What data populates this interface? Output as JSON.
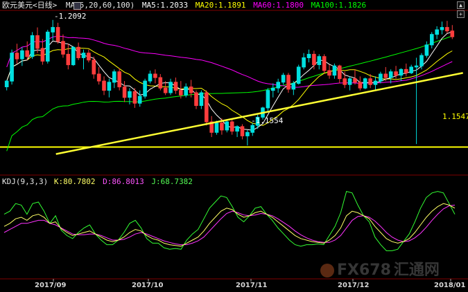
{
  "header": {
    "instrument": "欧元美元",
    "period": "<日线>",
    "ma_params": "MA(5,20,60,100)",
    "ma5": "MA5:1.2033",
    "ma20": "MA20:1.1891",
    "ma60": "MA60:1.1800",
    "ma100": "MA100:1.1826"
  },
  "kdj_header": {
    "params": "KDJ(9,3,3)",
    "k": "K:80.7802",
    "d": "D:86.8013",
    "j": "J:68.7382"
  },
  "annotations": {
    "high_label": "1.2092",
    "low_label": "1.1554",
    "support_level": "1.1547"
  },
  "x_axis_labels": [
    "2017/09",
    "2017/10",
    "2017/11",
    "2017/12",
    "2018/01"
  ],
  "watermark": {
    "brand": "FX678",
    "cn": "汇通网"
  },
  "colors": {
    "background": "#000000",
    "up_candle": "#00e0e0",
    "down_candle": "#ff3d3d",
    "ma5": "#ffffff",
    "ma20": "#ffff00",
    "ma60": "#ff00ff",
    "ma100": "#00ff00",
    "trendline": "#ffff33",
    "grid": "#800000"
  },
  "chart_data": {
    "type": "candlestick",
    "price_range": [
      1.143,
      1.213
    ],
    "support_line": 1.1547,
    "trendline": [
      [
        13,
        1.1535
      ],
      [
        88,
        1.1865
      ]
    ],
    "candles": [
      [
        1.1805,
        1.1835,
        1.179,
        1.183
      ],
      [
        1.183,
        1.1965,
        1.1815,
        1.195
      ],
      [
        1.195,
        1.199,
        1.1905,
        1.1925
      ],
      [
        1.1925,
        1.1975,
        1.1895,
        1.196
      ],
      [
        1.196,
        1.2,
        1.192,
        1.1935
      ],
      [
        1.1935,
        1.204,
        1.1925,
        1.2025
      ],
      [
        1.2025,
        1.206,
        1.195,
        1.197
      ],
      [
        1.197,
        1.201,
        1.19,
        1.1915
      ],
      [
        1.1915,
        1.205,
        1.1905,
        1.204
      ],
      [
        1.204,
        1.2092,
        1.2005,
        1.206
      ],
      [
        1.206,
        1.208,
        1.199,
        1.2
      ],
      [
        1.2,
        1.203,
        1.193,
        1.1945
      ],
      [
        1.1945,
        1.199,
        1.188,
        1.19
      ],
      [
        1.19,
        1.198,
        1.1895,
        1.1975
      ],
      [
        1.1975,
        1.1995,
        1.192,
        1.193
      ],
      [
        1.193,
        1.1965,
        1.188,
        1.195
      ],
      [
        1.195,
        1.1965,
        1.191,
        1.192
      ],
      [
        1.192,
        1.1935,
        1.184,
        1.186
      ],
      [
        1.186,
        1.189,
        1.1815,
        1.183
      ],
      [
        1.183,
        1.185,
        1.177,
        1.179
      ],
      [
        1.179,
        1.184,
        1.176,
        1.1825
      ],
      [
        1.1825,
        1.188,
        1.18,
        1.187
      ],
      [
        1.187,
        1.1885,
        1.179,
        1.1805
      ],
      [
        1.1805,
        1.183,
        1.174,
        1.176
      ],
      [
        1.176,
        1.18,
        1.173,
        1.1785
      ],
      [
        1.1785,
        1.18,
        1.1715,
        1.1735
      ],
      [
        1.1735,
        1.179,
        1.172,
        1.1765
      ],
      [
        1.1765,
        1.184,
        1.1755,
        1.183
      ],
      [
        1.183,
        1.1875,
        1.182,
        1.186
      ],
      [
        1.186,
        1.188,
        1.182,
        1.1845
      ],
      [
        1.1845,
        1.186,
        1.179,
        1.18
      ],
      [
        1.18,
        1.183,
        1.177,
        1.178
      ],
      [
        1.178,
        1.184,
        1.177,
        1.1825
      ],
      [
        1.1825,
        1.1845,
        1.1775,
        1.179
      ],
      [
        1.179,
        1.183,
        1.1755,
        1.177
      ],
      [
        1.177,
        1.182,
        1.176,
        1.1805
      ],
      [
        1.1805,
        1.1835,
        1.176,
        1.178
      ],
      [
        1.178,
        1.179,
        1.171,
        1.1725
      ],
      [
        1.1725,
        1.179,
        1.171,
        1.178
      ],
      [
        1.178,
        1.179,
        1.164,
        1.1655
      ],
      [
        1.1655,
        1.168,
        1.159,
        1.161
      ],
      [
        1.161,
        1.166,
        1.16,
        1.165
      ],
      [
        1.165,
        1.167,
        1.16,
        1.162
      ],
      [
        1.162,
        1.1665,
        1.161,
        1.1655
      ],
      [
        1.1655,
        1.1665,
        1.16,
        1.1615
      ],
      [
        1.1615,
        1.164,
        1.159,
        1.1635
      ],
      [
        1.1635,
        1.1645,
        1.158,
        1.1595
      ],
      [
        1.1595,
        1.162,
        1.1554,
        1.161
      ],
      [
        1.161,
        1.165,
        1.1595,
        1.164
      ],
      [
        1.164,
        1.1685,
        1.1625,
        1.1675
      ],
      [
        1.1675,
        1.172,
        1.1665,
        1.1715
      ],
      [
        1.1715,
        1.18,
        1.17,
        1.179
      ],
      [
        1.179,
        1.182,
        1.176,
        1.18
      ],
      [
        1.18,
        1.184,
        1.178,
        1.1825
      ],
      [
        1.1825,
        1.1865,
        1.1815,
        1.1855
      ],
      [
        1.1855,
        1.1865,
        1.178,
        1.1795
      ],
      [
        1.1795,
        1.183,
        1.177,
        1.182
      ],
      [
        1.182,
        1.19,
        1.1815,
        1.189
      ],
      [
        1.189,
        1.195,
        1.188,
        1.193
      ],
      [
        1.193,
        1.1965,
        1.191,
        1.1945
      ],
      [
        1.1945,
        1.196,
        1.188,
        1.19
      ],
      [
        1.19,
        1.1945,
        1.188,
        1.1935
      ],
      [
        1.1935,
        1.1945,
        1.186,
        1.1875
      ],
      [
        1.1875,
        1.19,
        1.184,
        1.1855
      ],
      [
        1.1855,
        1.1905,
        1.184,
        1.1895
      ],
      [
        1.1895,
        1.19,
        1.182,
        1.184
      ],
      [
        1.184,
        1.187,
        1.18,
        1.1815
      ],
      [
        1.1815,
        1.185,
        1.179,
        1.184
      ],
      [
        1.184,
        1.188,
        1.1815,
        1.1825
      ],
      [
        1.1825,
        1.185,
        1.179,
        1.18
      ],
      [
        1.18,
        1.1845,
        1.1795,
        1.184
      ],
      [
        1.184,
        1.186,
        1.18,
        1.1815
      ],
      [
        1.1815,
        1.185,
        1.179,
        1.183
      ],
      [
        1.183,
        1.187,
        1.182,
        1.186
      ],
      [
        1.186,
        1.189,
        1.183,
        1.1845
      ],
      [
        1.1845,
        1.188,
        1.182,
        1.187
      ],
      [
        1.187,
        1.1895,
        1.184,
        1.1855
      ],
      [
        1.1855,
        1.1885,
        1.183,
        1.188
      ],
      [
        1.188,
        1.1905,
        1.185,
        1.1865
      ],
      [
        1.1865,
        1.19,
        1.186,
        1.189
      ],
      [
        1.189,
        1.193,
        1.156,
        1.1895
      ],
      [
        1.1895,
        1.195,
        1.188,
        1.194
      ],
      [
        1.194,
        1.2,
        1.193,
        1.1985
      ],
      [
        1.1985,
        1.204,
        1.197,
        1.203
      ],
      [
        1.203,
        1.2065,
        1.201,
        1.205
      ],
      [
        1.205,
        1.2085,
        1.203,
        1.206
      ],
      [
        1.206,
        1.2088,
        1.2035,
        1.2045
      ],
      [
        1.2045,
        1.207,
        1.201,
        1.202
      ]
    ],
    "kdj": {
      "k": [
        58,
        62,
        68,
        70,
        66,
        72,
        74,
        70,
        62,
        64,
        55,
        50,
        46,
        48,
        50,
        52,
        48,
        44,
        40,
        38,
        40,
        44,
        50,
        54,
        52,
        46,
        42,
        40,
        36,
        34,
        33,
        32,
        36,
        40,
        44,
        52,
        62,
        70,
        78,
        82,
        80,
        74,
        70,
        72,
        76,
        78,
        74,
        70,
        64,
        58,
        52,
        46,
        42,
        40,
        38,
        37,
        36,
        40,
        46,
        56,
        72,
        78,
        76,
        72,
        68,
        58,
        50,
        42,
        38,
        36,
        38,
        42,
        50,
        60,
        70,
        78,
        84,
        88,
        86,
        82
      ],
      "d": [
        50,
        54,
        58,
        62,
        62,
        64,
        66,
        66,
        62,
        60,
        56,
        52,
        48,
        47,
        47,
        48,
        48,
        46,
        43,
        40,
        40,
        41,
        44,
        48,
        50,
        48,
        45,
        42,
        39,
        37,
        35,
        34,
        34,
        36,
        39,
        44,
        52,
        60,
        68,
        75,
        78,
        76,
        73,
        72,
        73,
        75,
        74,
        72,
        68,
        63,
        58,
        52,
        47,
        43,
        40,
        38,
        37,
        37,
        40,
        46,
        56,
        66,
        71,
        72,
        70,
        65,
        58,
        50,
        44,
        40,
        38,
        39,
        43,
        49,
        57,
        66,
        74,
        81,
        85,
        86
      ],
      "j": [
        74,
        78,
        88,
        86,
        74,
        88,
        90,
        78,
        62,
        72,
        53,
        46,
        42,
        50,
        56,
        60,
        48,
        40,
        34,
        34,
        40,
        50,
        62,
        66,
        56,
        42,
        36,
        36,
        30,
        28,
        29,
        28,
        40,
        48,
        54,
        68,
        82,
        90,
        98,
        96,
        84,
        70,
        64,
        72,
        82,
        84,
        74,
        66,
        56,
        48,
        40,
        34,
        32,
        34,
        34,
        35,
        34,
        46,
        58,
        76,
        104,
        102,
        86,
        72,
        64,
        44,
        34,
        26,
        26,
        28,
        38,
        48,
        64,
        82,
        96,
        102,
        104,
        102,
        88,
        74
      ]
    }
  }
}
